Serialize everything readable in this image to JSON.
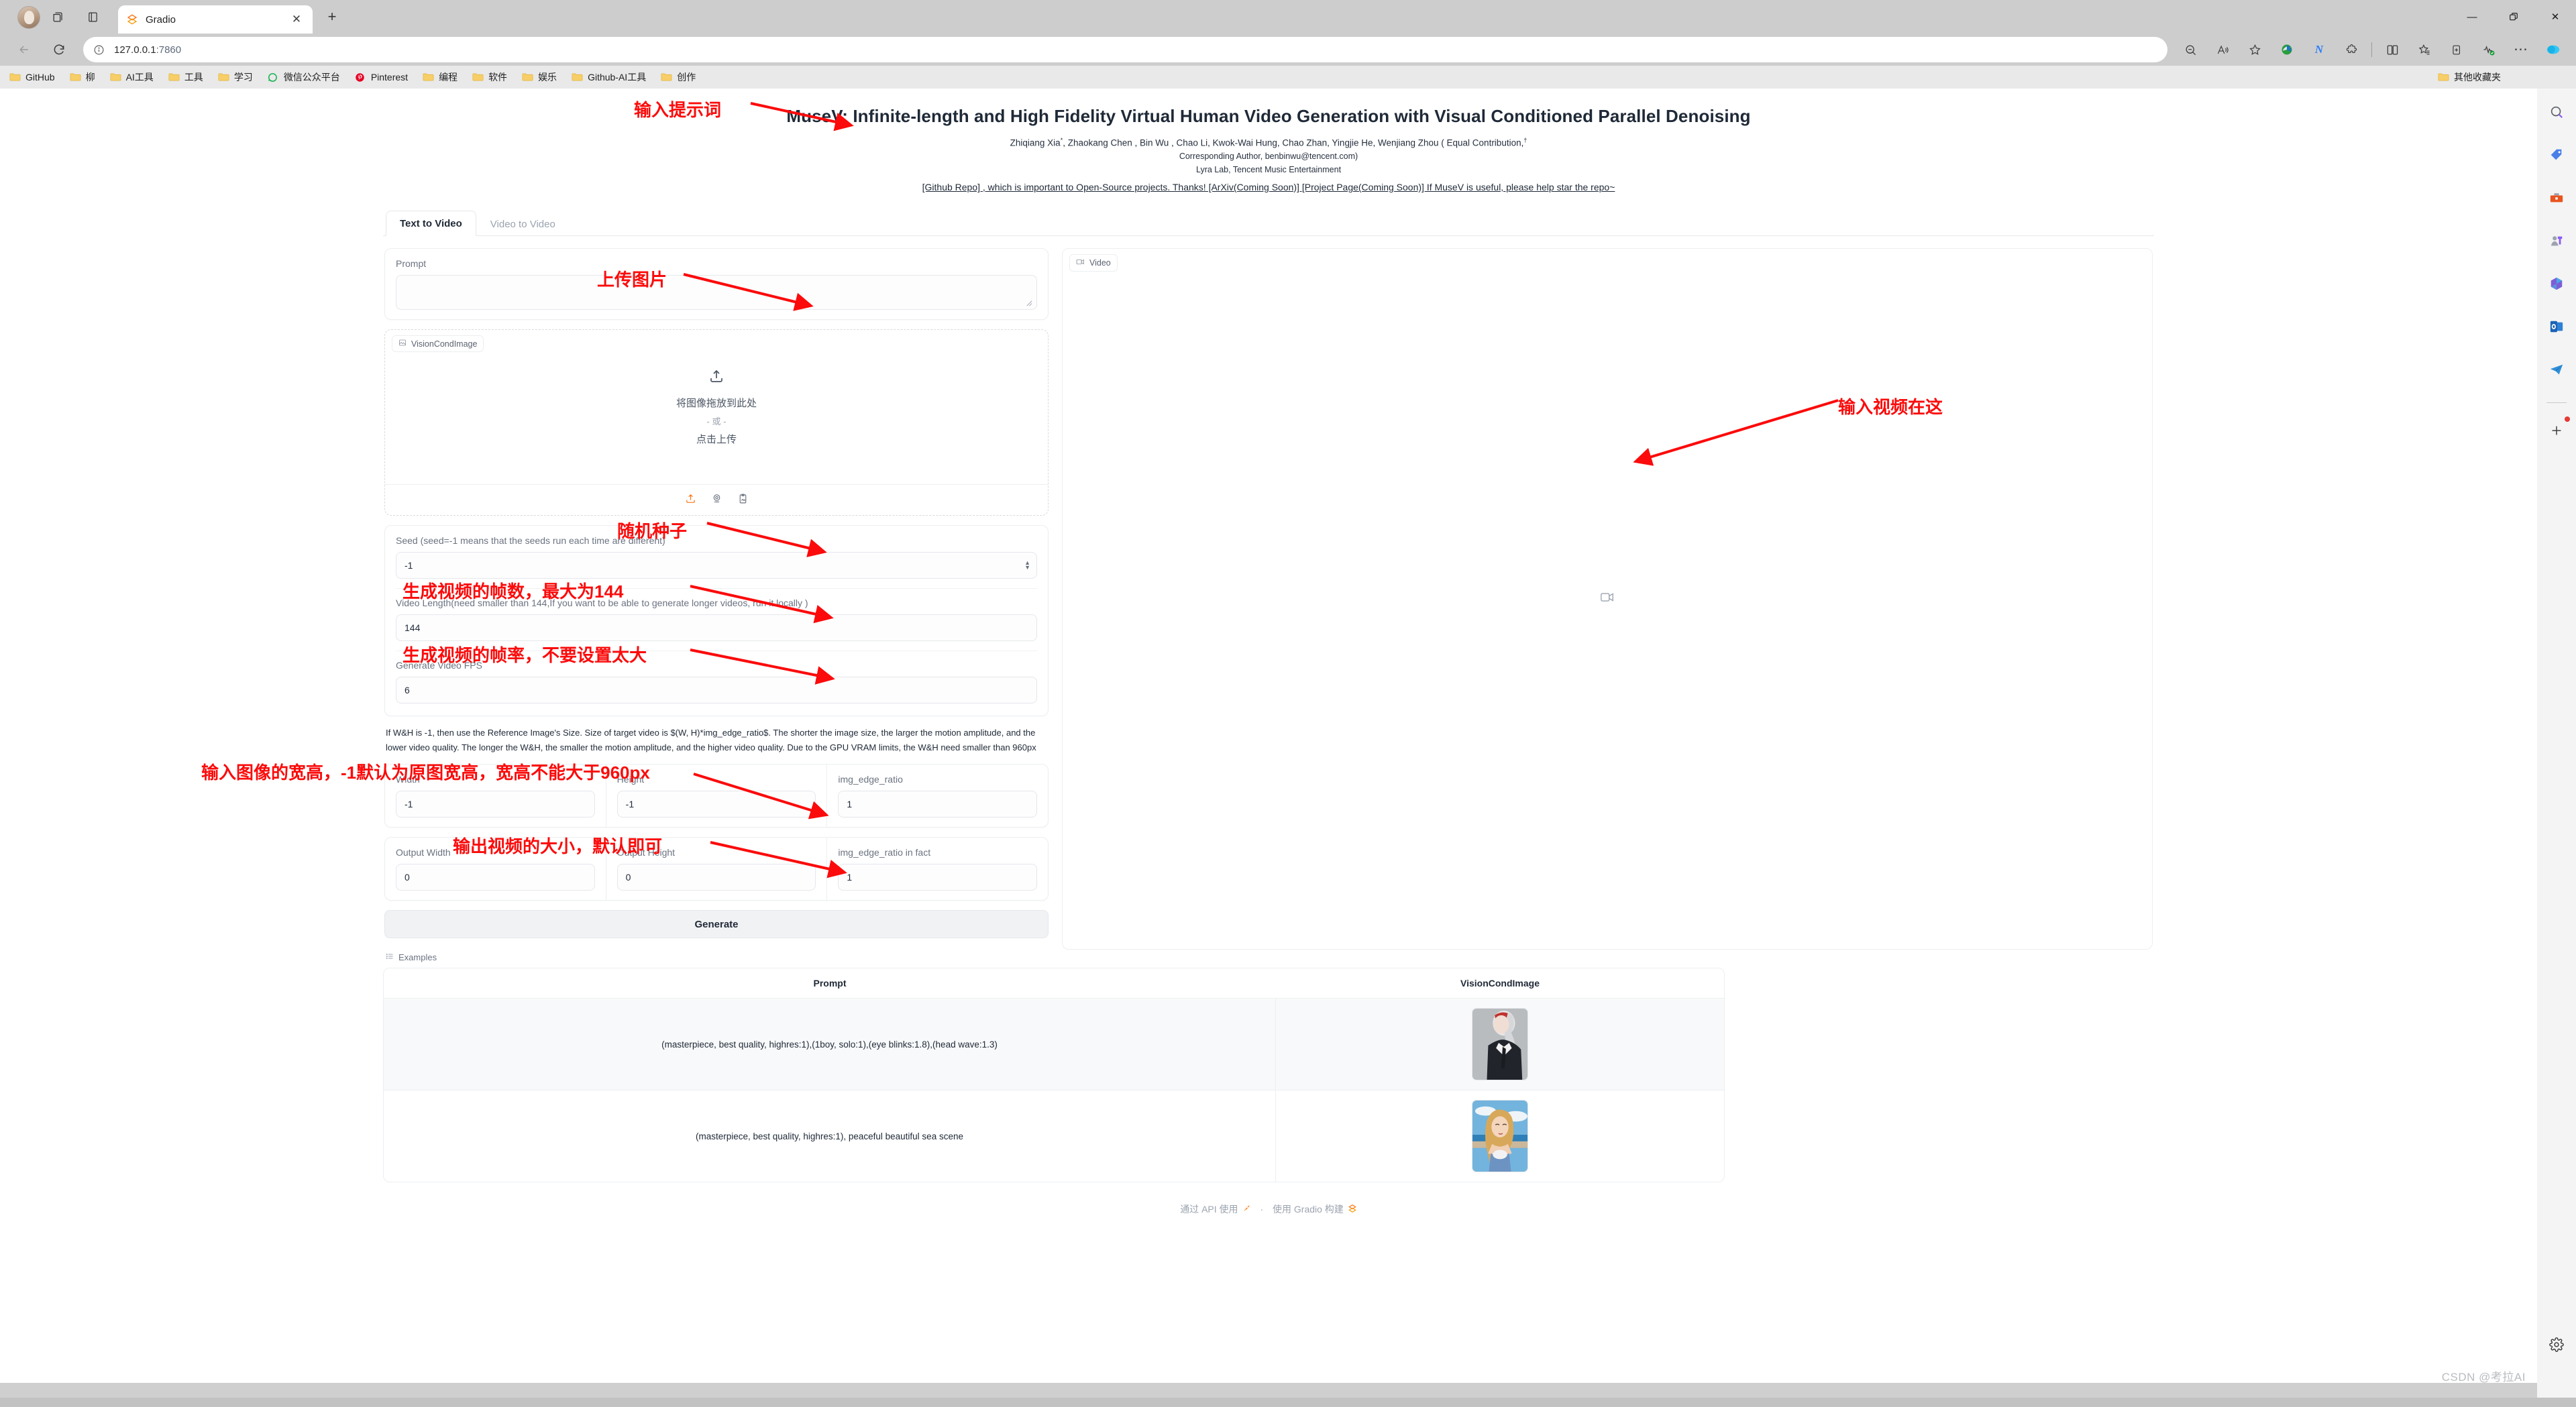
{
  "browser": {
    "tab_title": "Gradio",
    "tab_favicon": "gradio-logo-icon",
    "url": "127.0.0.1",
    "url_port": ":7860",
    "new_tab_label": "+",
    "window_controls": {
      "minimize": "—",
      "maximize": "❐",
      "close": "✕"
    },
    "bookmarks": [
      {
        "label": "GitHub",
        "icon": "folder-icon"
      },
      {
        "label": "柳",
        "icon": "folder-icon"
      },
      {
        "label": "AI工具",
        "icon": "folder-icon"
      },
      {
        "label": "工具",
        "icon": "folder-icon"
      },
      {
        "label": "学习",
        "icon": "folder-icon"
      },
      {
        "label": "微信公众平台",
        "icon": "wechat-icon"
      },
      {
        "label": "Pinterest",
        "icon": "pinterest-icon"
      },
      {
        "label": "编程",
        "icon": "folder-icon"
      },
      {
        "label": "软件",
        "icon": "folder-icon"
      },
      {
        "label": "娱乐",
        "icon": "folder-icon"
      },
      {
        "label": "Github-AI工具",
        "icon": "folder-icon"
      },
      {
        "label": "创作",
        "icon": "folder-icon"
      }
    ],
    "other_bookmarks": "其他收藏夹"
  },
  "paper": {
    "title": "MuseV: Infinite-length and High Fidelity Virtual Human Video Generation with Visual Conditioned Parallel Denoising",
    "authors_line1": "Zhiqiang Xia",
    "authors_rest": ", Zhaokang Chen , Bin Wu , Chao Li, Kwok-Wai Hung, Chao Zhan, Yingjie He, Wenjiang Zhou (  Equal Contribution,",
    "corresponding": "Corresponding Author, benbinwu@tencent.com)",
    "affiliation": "Lyra Lab, Tencent Music Entertainment",
    "links_text": "[Github Repo] , which is important to Open-Source projects. Thanks! [ArXiv(Coming Soon)] [Project Page(Coming Soon)] If MuseV is useful, please help star the repo~"
  },
  "tabs": [
    {
      "label": "Text to Video",
      "active": true
    },
    {
      "label": "Video to Video",
      "active": false
    }
  ],
  "form": {
    "prompt": {
      "label": "Prompt",
      "value": ""
    },
    "vision_cond_image": {
      "label": "VisionCondImage",
      "icon": "image-icon",
      "drop_text": "将图像拖放到此处",
      "or_text": "- 或 -",
      "click_text": "点击上传",
      "upload_icon": "upload-icon",
      "tools": [
        "upload-icon",
        "webcam-icon",
        "clipboard-icon"
      ]
    },
    "seed": {
      "label": "Seed (seed=-1 means that the seeds run each time are different)",
      "value": "-1"
    },
    "video_length": {
      "label": "Video Length(need smaller than 144,If you want to be able to generate longer videos, run it locally )",
      "value": "144"
    },
    "fps": {
      "label": "Generate Video FPS",
      "value": "6"
    },
    "wh_help": "If W&H is -1, then use the Reference Image's Size. Size of target video is $(W, H)*img_edge_ratio$. The shorter the image size, the larger the motion amplitude, and the lower video quality. The longer the W&H, the smaller the motion amplitude, and the higher video quality. Due to the GPU VRAM limits, the W&H need smaller than 960px",
    "width": {
      "label": "Width",
      "value": "-1"
    },
    "height": {
      "label": "Height",
      "value": "-1"
    },
    "img_edge_ratio": {
      "label": "img_edge_ratio",
      "value": "1"
    },
    "output_width": {
      "label": "Output Width",
      "value": "0"
    },
    "output_height": {
      "label": "Output Height",
      "value": "0"
    },
    "img_edge_ratio_in_fact": {
      "label": "img_edge_ratio in fact",
      "value": "1"
    },
    "generate_button": "Generate"
  },
  "video_panel": {
    "label": "Video",
    "icon": "video-camera-icon",
    "placeholder_icon": "video-camera-icon"
  },
  "examples": {
    "label": "Examples",
    "icon": "list-icon",
    "columns": [
      "Prompt",
      "VisionCondImage"
    ],
    "rows": [
      {
        "prompt": "(masterpiece, best quality, highres:1),(1boy, solo:1),(eye blinks:1.8),(head wave:1.3)",
        "thumb": "anime-boy-suit-thumbnail"
      },
      {
        "prompt": "(masterpiece, best quality, highres:1), peaceful beautiful sea scene",
        "thumb": "woman-beach-thumbnail"
      }
    ]
  },
  "footer": {
    "api_text": "通过 API 使用",
    "api_icon": "rocket-icon",
    "dot": "·",
    "built_text": "使用 Gradio 构建",
    "built_icon": "gradio-logo-icon"
  },
  "annotations": [
    {
      "id": "prompt",
      "text": "输入提示词"
    },
    {
      "id": "upload",
      "text": "上传图片"
    },
    {
      "id": "seed",
      "text": "随机种子"
    },
    {
      "id": "length",
      "text": "生成视频的帧数，最大为144"
    },
    {
      "id": "fps",
      "text": "生成视频的帧率，不要设置太大"
    },
    {
      "id": "wh",
      "text": "输入图像的宽高，-1默认为原图宽高，宽高不能大于960px"
    },
    {
      "id": "output",
      "text": "输出视频的大小，默认即可"
    },
    {
      "id": "video",
      "text": "输入视频在这"
    }
  ],
  "watermark": "CSDN @考拉AI",
  "colors": {
    "annotation_red": "#fb0b0b",
    "accent_orange": "#f97316",
    "text_dark": "#1f2937"
  }
}
